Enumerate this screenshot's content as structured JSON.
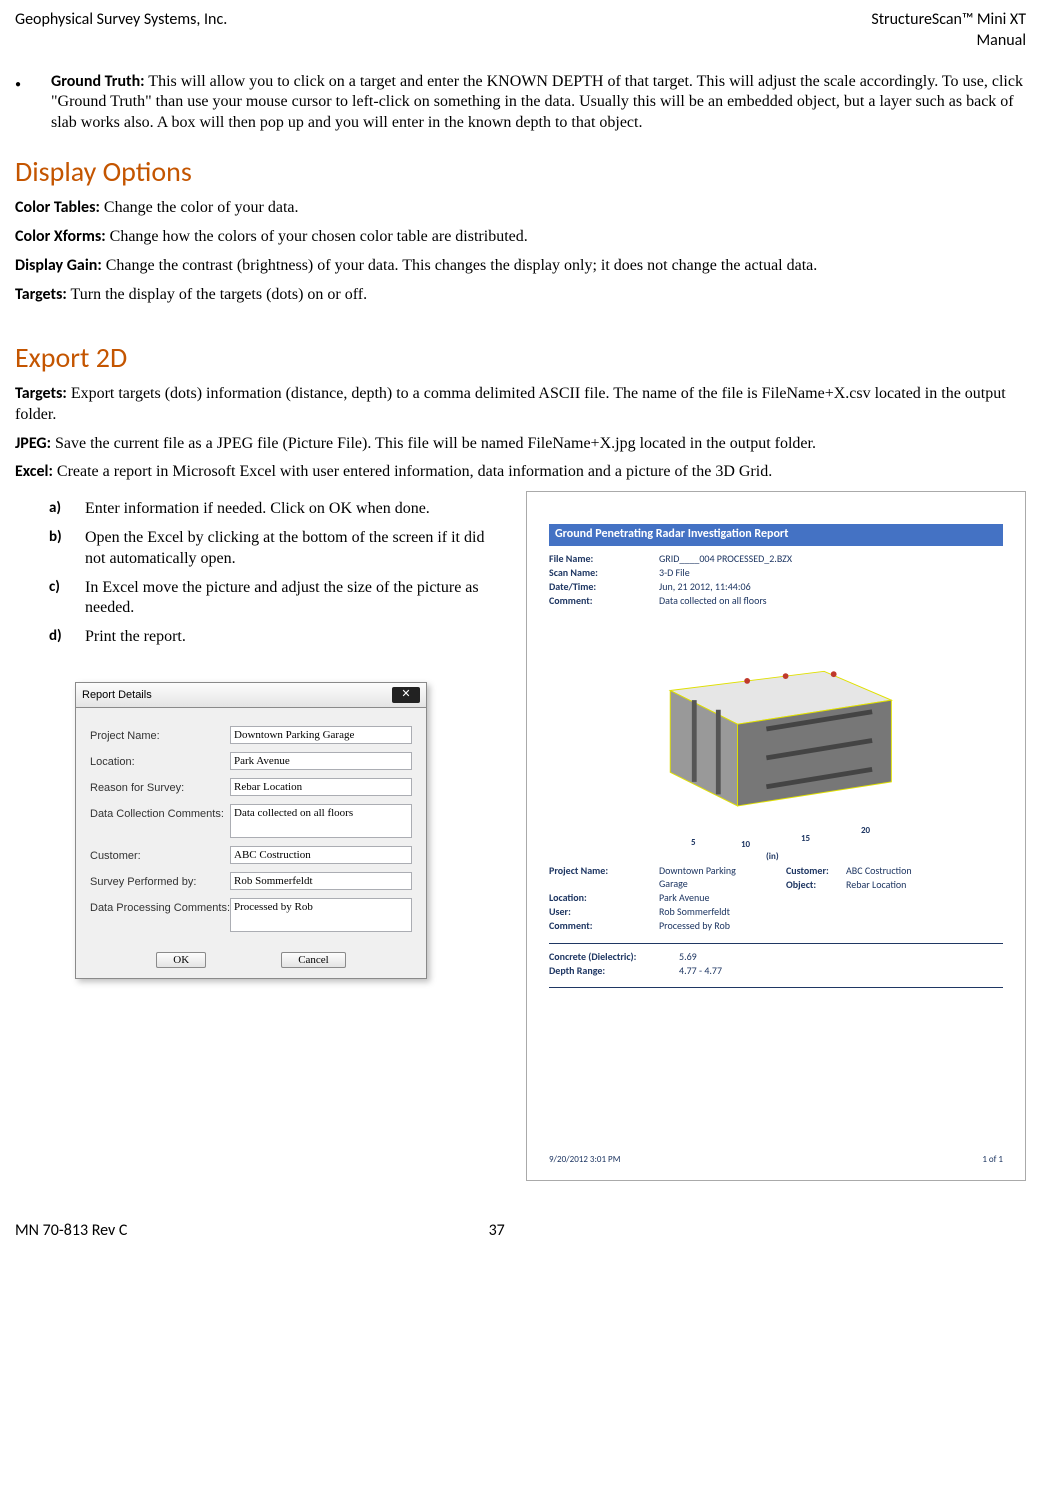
{
  "header": {
    "left": "Geophysical Survey Systems, Inc.",
    "right1": "StructureScan™ Mini XT",
    "right2": "Manual"
  },
  "footer": {
    "left": "MN 70-813 Rev C",
    "center": "37"
  },
  "groundTruth": {
    "label": "Ground Truth:",
    "text": " This will allow you to click on a target and enter the KNOWN DEPTH of that target. This will adjust the scale accordingly. To use, click \"Ground Truth\" than use your mouse cursor to left-click on something in the data. Usually this will be an embedded object, but a layer such as back of slab works also. A box will then pop up and you will enter in the known depth to that object."
  },
  "displayOptions": {
    "heading": "Display Options",
    "items": [
      {
        "label": "Color Tables:",
        "text": " Change the color of your data."
      },
      {
        "label": "Color Xforms:",
        "text": " Change how the colors of your chosen color table are distributed."
      },
      {
        "label": "Display Gain:",
        "text": " Change the contrast (brightness) of your data. This changes the display only; it does not change the actual data."
      },
      {
        "label": "Targets:",
        "text": " Turn the display of the targets (dots) on or off."
      }
    ]
  },
  "export2d": {
    "heading": "Export 2D",
    "items": [
      {
        "label": "Targets:",
        "text": " Export targets (dots) information (distance, depth) to a comma delimited ASCII file. The name of the file is FileName+X.csv located in the output folder."
      },
      {
        "label": "JPEG:",
        "text": " Save the current file as a JPEG file (Picture File). This file will be named FileName+X.jpg located in the output folder."
      },
      {
        "label": "Excel:",
        "text": " Create a report in Microsoft Excel with user entered information, data information and a picture of the 3D Grid."
      }
    ],
    "steps": [
      {
        "marker": "a)",
        "text": "Enter information if needed. Click on OK when done."
      },
      {
        "marker": "b)",
        "text": "Open the Excel by clicking at the bottom of the screen if it did not automatically open."
      },
      {
        "marker": "c)",
        "text": "In Excel move the picture and adjust the size of the picture as needed."
      },
      {
        "marker": "d)",
        "text": "Print the report."
      }
    ]
  },
  "dialog": {
    "title": "Report Details",
    "fields": {
      "projectName": {
        "label": "Project Name:",
        "value": "Downtown Parking Garage"
      },
      "location": {
        "label": "Location:",
        "value": "Park Avenue"
      },
      "reason": {
        "label": "Reason for Survey:",
        "value": "Rebar Location"
      },
      "dataComments": {
        "label": "Data Collection Comments:",
        "value": "Data collected on all floors"
      },
      "customer": {
        "label": "Customer:",
        "value": "ABC Costruction"
      },
      "performedBy": {
        "label": "Survey Performed by:",
        "value": "Rob Sommerfeldt"
      },
      "procComments": {
        "label": "Data Processing Comments:",
        "value": "Processed by Rob"
      }
    },
    "buttons": {
      "ok": "OK",
      "cancel": "Cancel"
    }
  },
  "report": {
    "title": "Ground Penetrating Radar Investigation Report",
    "meta": [
      {
        "k": "File Name:",
        "v": "GRID____004 PROCESSED_2.BZX"
      },
      {
        "k": "Scan Name:",
        "v": "3-D File"
      },
      {
        "k": "Date/Time:",
        "v": "Jun, 21 2012, 11:44:06"
      },
      {
        "k": "Comment:",
        "v": "Data collected on all floors"
      }
    ],
    "axisTicks": [
      "5",
      "10",
      "15",
      "20"
    ],
    "axisUnit": "(in)",
    "project": [
      {
        "k": "Project Name:",
        "v": "Downtown Parking Garage"
      },
      {
        "k": "Location:",
        "v": "Park Avenue"
      },
      {
        "k": "User:",
        "v": "Rob Sommerfeldt"
      },
      {
        "k": "Comment:",
        "v": "Processed by Rob"
      }
    ],
    "projectRight": [
      {
        "k": "Customer:",
        "v": "ABC Costruction"
      },
      {
        "k": "Object:",
        "v": "Rebar Location"
      }
    ],
    "analysis": [
      {
        "k": "Concrete (Dielectric):",
        "v": "5.69"
      },
      {
        "k": "Depth Range:",
        "v": "4.77 - 4.77"
      }
    ],
    "footer": {
      "left": "9/20/2012 3:01 PM",
      "right": "1 of 1"
    }
  }
}
